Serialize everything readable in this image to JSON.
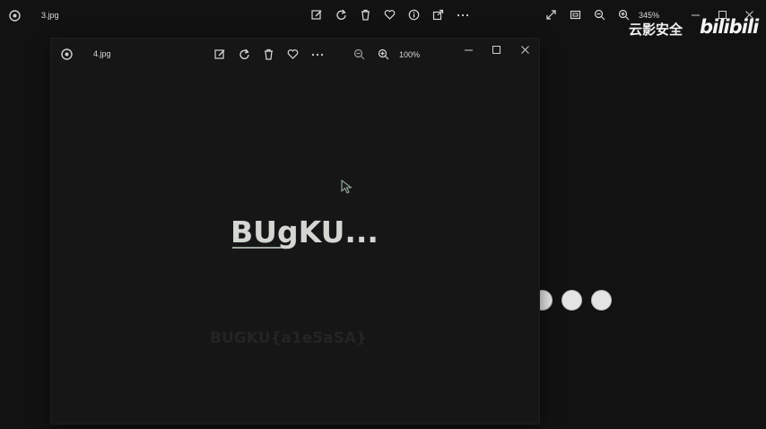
{
  "back_window": {
    "filename": "3.jpg",
    "zoom": "345%"
  },
  "front_window": {
    "filename": "4.jpg",
    "zoom": "100%",
    "image": {
      "logo_text": "BUgKU...",
      "flag_text": "BUGKU{a1e5aSA}"
    }
  },
  "watermark": {
    "channel": "云影安全",
    "site": "bilibili"
  },
  "icons": [
    "photos-app-icon",
    "edit-icon",
    "rotate-icon",
    "delete-icon",
    "favorite-icon",
    "info-icon",
    "share-icon",
    "more-icon",
    "fullscreen-icon",
    "fit-icon",
    "zoom-out-icon",
    "zoom-in-icon",
    "minimize-icon",
    "maximize-icon",
    "close-icon",
    "cursor-icon"
  ]
}
